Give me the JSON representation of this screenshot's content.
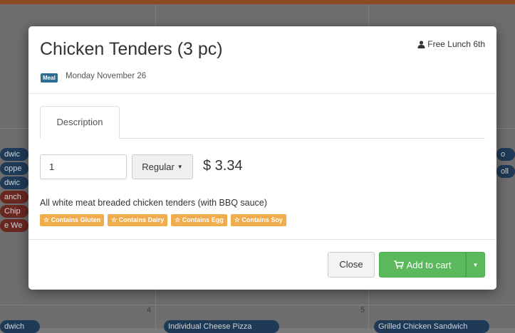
{
  "background": {
    "left_items": [
      "dwic",
      "oppe",
      "dwic",
      "anch",
      "Chip",
      "e We"
    ],
    "right_items": [
      "o",
      "oll"
    ],
    "bottom_items": [
      "dwich",
      "Individual Cheese Pizza",
      "Grilled Chicken Sandwich"
    ],
    "day_numbers": [
      "4",
      "5"
    ]
  },
  "modal": {
    "title": "Chicken Tenders (3 pc)",
    "user": "Free Lunch 6th",
    "badge": "Meal",
    "date": "Monday November 26",
    "tab": "Description",
    "quantity": "1",
    "size": "Regular",
    "price": "$ 3.34",
    "description": "All white meat breaded chicken tenders (with BBQ sauce)",
    "allergens": [
      "☆ Contains Gluten",
      "☆ Contains Dairy",
      "☆ Contains Egg",
      "☆ Contains Soy"
    ],
    "close": "Close",
    "add_to_cart": "Add to cart"
  },
  "colors": {
    "primary": "#5cb85c",
    "warning": "#f0ad4e",
    "badge": "#2f6c94"
  }
}
